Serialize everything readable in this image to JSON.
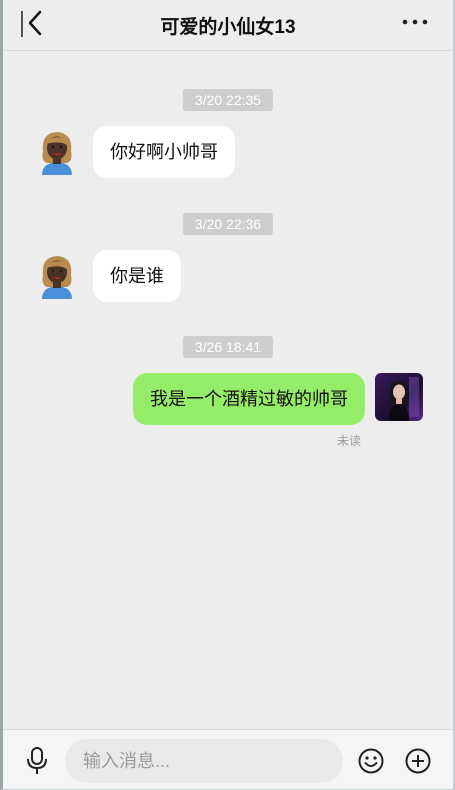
{
  "header": {
    "title": "可爱的小仙女13",
    "back_icon": "chevron-left-icon",
    "more_icon": "more-horizontal-icon"
  },
  "messages": [
    {
      "timestamp": "3/20 22:35",
      "direction": "incoming",
      "text": "你好啊小帅哥",
      "avatar": "contact-avatar"
    },
    {
      "timestamp": "3/20 22:36",
      "direction": "incoming",
      "text": "你是谁",
      "avatar": "contact-avatar"
    },
    {
      "timestamp": "3/26 18:41",
      "direction": "outgoing",
      "text": "我是一个酒精过敏的帅哥",
      "avatar": "user-avatar",
      "status": "未读"
    }
  ],
  "input": {
    "placeholder": "输入消息...",
    "value": ""
  },
  "toolbar": {
    "voice_icon": "microphone-icon",
    "emoji_icon": "smiley-icon",
    "plus_icon": "plus-circle-icon"
  },
  "colors": {
    "background": "#ededed",
    "incoming_bubble": "#ffffff",
    "outgoing_bubble": "#95ec69",
    "timestamp_bg": "#cecece"
  }
}
